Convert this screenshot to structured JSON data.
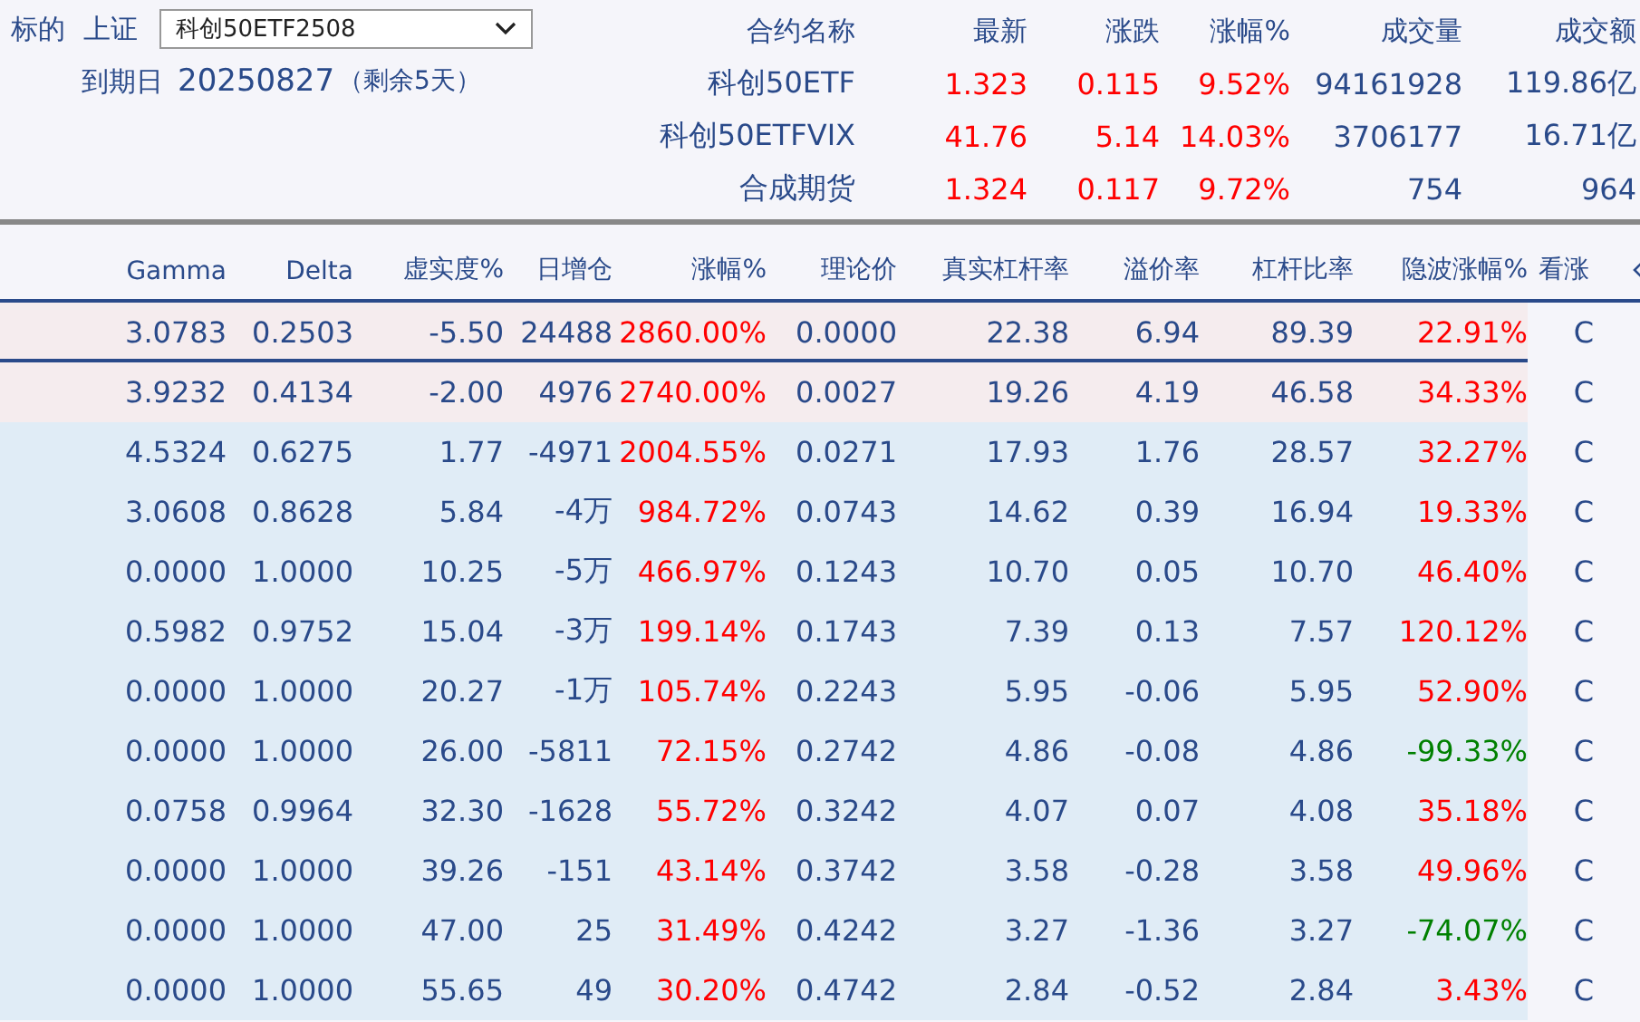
{
  "underlying": {
    "label": "标的",
    "exchange": "上证",
    "contract_select": {
      "value": "科创50ETF2508"
    },
    "expiry_label": "到期日",
    "expiry_date": "20250827",
    "remaining": "（剩余5天）"
  },
  "quotes": {
    "columns": [
      "合约名称",
      "最新",
      "涨跌",
      "涨幅%",
      "成交量",
      "成交额"
    ],
    "rows": [
      {
        "cells": [
          "科创50ETF",
          "1.323",
          "0.115",
          "9.52%",
          "94161928",
          "119.86亿"
        ]
      },
      {
        "cells": [
          "科创50ETFVIX",
          "41.76",
          "5.14",
          "14.03%",
          "3706177",
          "16.71亿"
        ]
      },
      {
        "cells": [
          "合成期货",
          "1.324",
          "0.117",
          "9.72%",
          "754",
          "964"
        ]
      }
    ]
  },
  "options": {
    "columns": [
      "Gamma",
      "Delta",
      "虚实度%",
      "日增仓",
      "涨幅%",
      "理论价",
      "真实杠杆率",
      "溢价率",
      "杠杆比率",
      "隐波涨幅%",
      "看涨"
    ],
    "rows": [
      {
        "highlighted": true,
        "selected": true,
        "cells": [
          "3.0783",
          "0.2503",
          "-5.50",
          "24488",
          "2860.00%",
          "0.0000",
          "22.38",
          "6.94",
          "89.39",
          "22.91%",
          "C"
        ],
        "iv_up": true
      },
      {
        "highlighted": true,
        "selected": false,
        "cells": [
          "3.9232",
          "0.4134",
          "-2.00",
          "4976",
          "2740.00%",
          "0.0027",
          "19.26",
          "4.19",
          "46.58",
          "34.33%",
          "C"
        ],
        "iv_up": true
      },
      {
        "highlighted": false,
        "selected": false,
        "cells": [
          "4.5324",
          "0.6275",
          "1.77",
          "-4971",
          "2004.55%",
          "0.0271",
          "17.93",
          "1.76",
          "28.57",
          "32.27%",
          "C"
        ],
        "iv_up": true
      },
      {
        "highlighted": false,
        "selected": false,
        "cells": [
          "3.0608",
          "0.8628",
          "5.84",
          "-4万",
          "984.72%",
          "0.0743",
          "14.62",
          "0.39",
          "16.94",
          "19.33%",
          "C"
        ],
        "iv_up": true
      },
      {
        "highlighted": false,
        "selected": false,
        "cells": [
          "0.0000",
          "1.0000",
          "10.25",
          "-5万",
          "466.97%",
          "0.1243",
          "10.70",
          "0.05",
          "10.70",
          "46.40%",
          "C"
        ],
        "iv_up": true
      },
      {
        "highlighted": false,
        "selected": false,
        "cells": [
          "0.5982",
          "0.9752",
          "15.04",
          "-3万",
          "199.14%",
          "0.1743",
          "7.39",
          "0.13",
          "7.57",
          "120.12%",
          "C"
        ],
        "iv_up": true
      },
      {
        "highlighted": false,
        "selected": false,
        "cells": [
          "0.0000",
          "1.0000",
          "20.27",
          "-1万",
          "105.74%",
          "0.2243",
          "5.95",
          "-0.06",
          "5.95",
          "52.90%",
          "C"
        ],
        "iv_up": true
      },
      {
        "highlighted": false,
        "selected": false,
        "cells": [
          "0.0000",
          "1.0000",
          "26.00",
          "-5811",
          "72.15%",
          "0.2742",
          "4.86",
          "-0.08",
          "4.86",
          "-99.33%",
          "C"
        ],
        "iv_up": false
      },
      {
        "highlighted": false,
        "selected": false,
        "cells": [
          "0.0758",
          "0.9964",
          "32.30",
          "-1628",
          "55.72%",
          "0.3242",
          "4.07",
          "0.07",
          "4.08",
          "35.18%",
          "C"
        ],
        "iv_up": true
      },
      {
        "highlighted": false,
        "selected": false,
        "cells": [
          "0.0000",
          "1.0000",
          "39.26",
          "-151",
          "43.14%",
          "0.3742",
          "3.58",
          "-0.28",
          "3.58",
          "49.96%",
          "C"
        ],
        "iv_up": true
      },
      {
        "highlighted": false,
        "selected": false,
        "cells": [
          "0.0000",
          "1.0000",
          "47.00",
          "25",
          "31.49%",
          "0.4242",
          "3.27",
          "-1.36",
          "3.27",
          "-74.07%",
          "C"
        ],
        "iv_up": false
      },
      {
        "highlighted": false,
        "selected": false,
        "cells": [
          "0.0000",
          "1.0000",
          "55.65",
          "49",
          "30.20%",
          "0.4742",
          "2.84",
          "-0.52",
          "2.84",
          "3.43%",
          "C"
        ],
        "iv_up": true
      }
    ]
  }
}
